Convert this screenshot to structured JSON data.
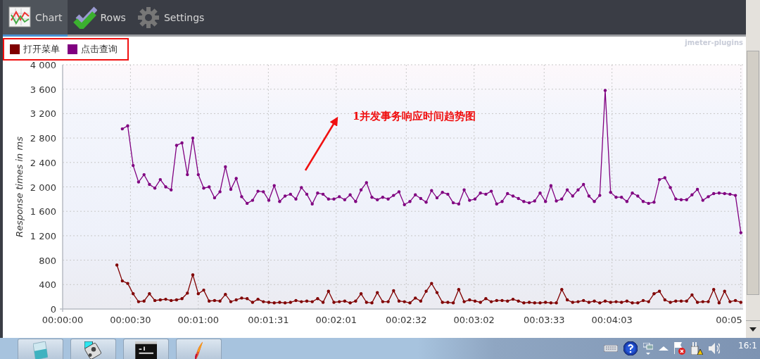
{
  "tabs": [
    {
      "label": "Chart",
      "kind": "chart",
      "selected": true
    },
    {
      "label": "Rows",
      "kind": "check",
      "selected": false
    },
    {
      "label": "Settings",
      "kind": "gear",
      "selected": false
    }
  ],
  "chart": {
    "legend_highlighted": true,
    "brand": "jmeter-plugins",
    "chart_data": {
      "type": "line",
      "grid": true,
      "ylabel": "Response times in ms",
      "xlim": [
        0,
        301
      ],
      "ylim": [
        0,
        4000
      ],
      "xticks": [
        {
          "value": 0,
          "label": "00:00:00"
        },
        {
          "value": 30,
          "label": "00:00:30"
        },
        {
          "value": 60,
          "label": "00:01:00"
        },
        {
          "value": 91,
          "label": "00:01:31"
        },
        {
          "value": 121,
          "label": "00:02:01"
        },
        {
          "value": 152,
          "label": "00:02:32"
        },
        {
          "value": 182,
          "label": "00:03:02"
        },
        {
          "value": 213,
          "label": "00:03:33"
        },
        {
          "value": 243,
          "label": "00:04:03"
        },
        {
          "value": 300,
          "label": "00:05"
        }
      ],
      "yticks": [
        {
          "value": 0,
          "label": "0"
        },
        {
          "value": 400,
          "label": "400"
        },
        {
          "value": 800,
          "label": "800"
        },
        {
          "value": 1200,
          "label": "1 200"
        },
        {
          "value": 1600,
          "label": "1 600"
        },
        {
          "value": 2000,
          "label": "2 000"
        },
        {
          "value": 2400,
          "label": "2 400"
        },
        {
          "value": 2800,
          "label": "2 800"
        },
        {
          "value": 3200,
          "label": "3 200"
        },
        {
          "value": 3600,
          "label": "3 600"
        },
        {
          "value": 4000,
          "label": "4 000"
        }
      ],
      "x": [
        24,
        26.4,
        28.8,
        31.2,
        33.6,
        36,
        38.4,
        40.8,
        43.2,
        45.6,
        48,
        50.4,
        52.8,
        55.2,
        57.6,
        60,
        62.4,
        64.8,
        67.2,
        69.6,
        72,
        74.4,
        76.8,
        79.2,
        81.6,
        84,
        86.4,
        88.8,
        91.2,
        93.6,
        96,
        98.4,
        100.8,
        103.2,
        105.6,
        108,
        110.4,
        112.8,
        115.2,
        117.6,
        120,
        122.4,
        124.8,
        127.2,
        129.6,
        132,
        134.4,
        136.8,
        139.2,
        141.6,
        144,
        146.4,
        148.8,
        151.2,
        153.6,
        156,
        158.4,
        160.8,
        163.2,
        165.6,
        168,
        170.4,
        172.8,
        175.2,
        177.6,
        180,
        182.4,
        184.8,
        187.2,
        189.6,
        192,
        194.4,
        196.8,
        199.2,
        201.6,
        204,
        206.4,
        208.8,
        211.2,
        213.6,
        216,
        218.4,
        220.8,
        223.2,
        225.6,
        228,
        230.4,
        232.8,
        235.2,
        237.6,
        240,
        242.4,
        244.8,
        247.2,
        249.6,
        252,
        254.4,
        256.8,
        259.2,
        261.6,
        264,
        266.4,
        268.8,
        271.2,
        273.6,
        276,
        278.4,
        280.8,
        283.2,
        285.6,
        288,
        290.4,
        292.8,
        295.2,
        297.6,
        300
      ],
      "series": [
        {
          "name": "打开菜单",
          "color": "#800000",
          "values": [
            720,
            460,
            420,
            250,
            120,
            130,
            250,
            140,
            150,
            160,
            140,
            150,
            170,
            260,
            560,
            250,
            310,
            130,
            140,
            130,
            240,
            120,
            150,
            180,
            170,
            110,
            160,
            120,
            110,
            100,
            110,
            100,
            110,
            140,
            120,
            130,
            120,
            170,
            110,
            290,
            110,
            120,
            130,
            100,
            130,
            250,
            110,
            100,
            270,
            120,
            120,
            300,
            130,
            120,
            100,
            180,
            130,
            290,
            420,
            270,
            110,
            110,
            100,
            320,
            120,
            150,
            130,
            110,
            170,
            120,
            140,
            140,
            130,
            160,
            130,
            100,
            110,
            100,
            100,
            110,
            100,
            100,
            320,
            150,
            110,
            120,
            140,
            110,
            130,
            100,
            130,
            110,
            120,
            110,
            130,
            100,
            100,
            140,
            120,
            250,
            290,
            150,
            110,
            130,
            130,
            130,
            230,
            110,
            120,
            120,
            320,
            100,
            290,
            120,
            140,
            110
          ]
        },
        {
          "name": "点击查询",
          "color": "#800080",
          "values": [
            null,
            2950,
            3000,
            2350,
            2080,
            2200,
            2040,
            1980,
            2120,
            2000,
            1950,
            2680,
            2720,
            2200,
            2800,
            2200,
            1980,
            2000,
            1820,
            1920,
            2330,
            1960,
            2140,
            1840,
            1730,
            1780,
            1930,
            1920,
            1780,
            2020,
            1760,
            1850,
            1880,
            1800,
            1990,
            1880,
            1720,
            1900,
            1880,
            1800,
            1800,
            1840,
            1790,
            1870,
            1760,
            1950,
            2070,
            1830,
            1790,
            1830,
            1800,
            1860,
            1920,
            1710,
            1760,
            1870,
            1810,
            1750,
            1940,
            1820,
            1910,
            1880,
            1740,
            1720,
            1950,
            1780,
            1800,
            1900,
            1880,
            1930,
            1720,
            1760,
            1890,
            1850,
            1810,
            1760,
            1740,
            1770,
            1900,
            1760,
            2020,
            1770,
            1800,
            1950,
            1850,
            1950,
            2040,
            1850,
            1760,
            1860,
            3580,
            1910,
            1830,
            1830,
            1760,
            1900,
            1850,
            1760,
            1730,
            1750,
            2120,
            2150,
            1990,
            1800,
            1790,
            1790,
            1870,
            1960,
            1780,
            1840,
            1890,
            1900,
            1890,
            1880,
            1860,
            1250
          ]
        }
      ],
      "annotations": [
        "1并发事务响应时间趋势图"
      ]
    }
  },
  "taskbar": {
    "apps": [
      {
        "kind": "notepad"
      },
      {
        "kind": "device"
      },
      {
        "kind": "console"
      },
      {
        "kind": "feather"
      }
    ],
    "tray": [
      {
        "kind": "keyboard"
      },
      {
        "kind": "help"
      },
      {
        "kind": "windows"
      },
      {
        "kind": "arrow"
      },
      {
        "kind": "flag"
      },
      {
        "kind": "power"
      },
      {
        "kind": "speaker"
      }
    ],
    "clock": "16:1"
  }
}
